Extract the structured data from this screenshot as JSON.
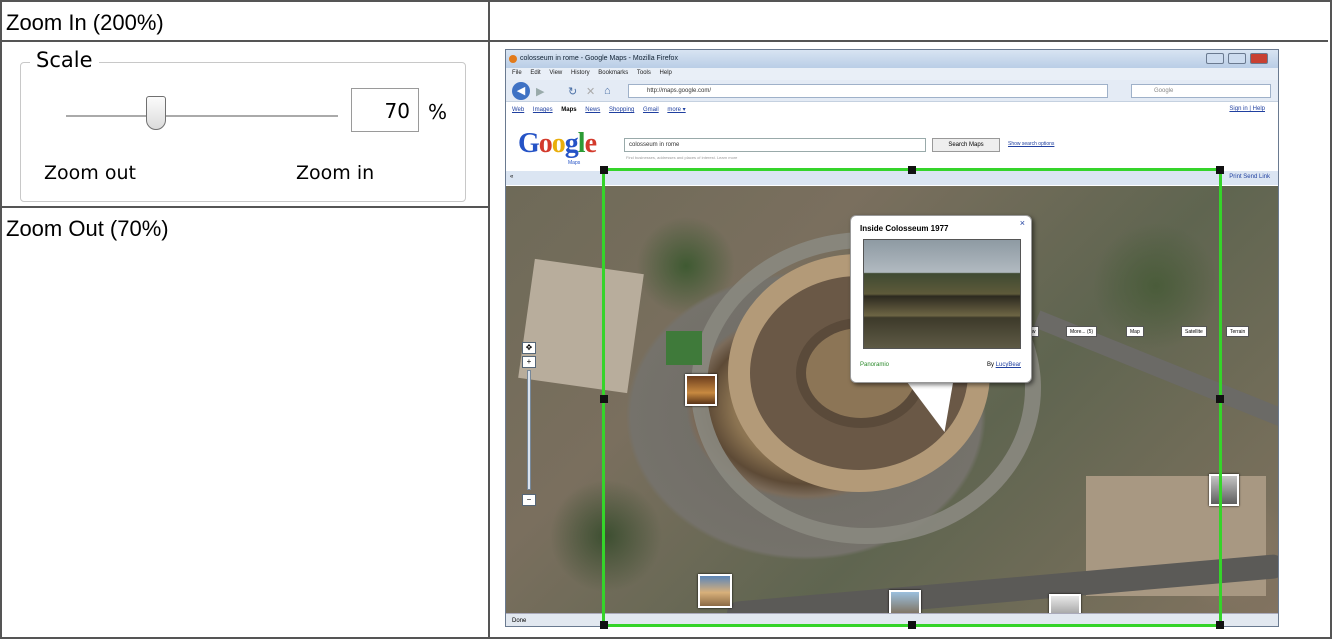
{
  "panels": {
    "zoom_in_title": "Zoom In (200%)",
    "zoom_out_title": "Zoom Out (70%)"
  },
  "scale": {
    "legend": "Scale",
    "value": "70",
    "unit": "%",
    "slider_level": 0.33,
    "zoom_out_label": "Zoom out",
    "zoom_in_label": "Zoom in"
  },
  "browser": {
    "title": "colosseum in rome - Google Maps - Mozilla Firefox",
    "menu": [
      "File",
      "Edit",
      "View",
      "History",
      "Bookmarks",
      "Tools",
      "Help"
    ],
    "url": "http://maps.google.com/",
    "search_placeholder": "Google",
    "google_links": [
      "Web",
      "Images",
      "Maps",
      "News",
      "Shopping",
      "Gmail",
      "more ▾"
    ],
    "current_link": "Maps",
    "sign_in": "Sign in | Help",
    "logo_sub": "Maps",
    "search_value": "colosseum in rome",
    "search_hint": "Find businesses, addresses and places of interest. Learn more",
    "search_button": "Search Maps",
    "search_options": "Show search options",
    "map_tools": "«",
    "print_links": "Print  Send  Link",
    "map_buttons": [
      "Street View",
      "More... (5)",
      "Map",
      "Satellite",
      "Terrain"
    ],
    "status": "Done"
  },
  "popup": {
    "title": "Inside Colosseum 1977",
    "close": "×",
    "source": "Panoramio",
    "by_prefix": "By",
    "by_name": "LucyBear"
  },
  "colors": {
    "selection": "#35d42a",
    "border": "#555555",
    "google_blue": "#2553c6"
  }
}
